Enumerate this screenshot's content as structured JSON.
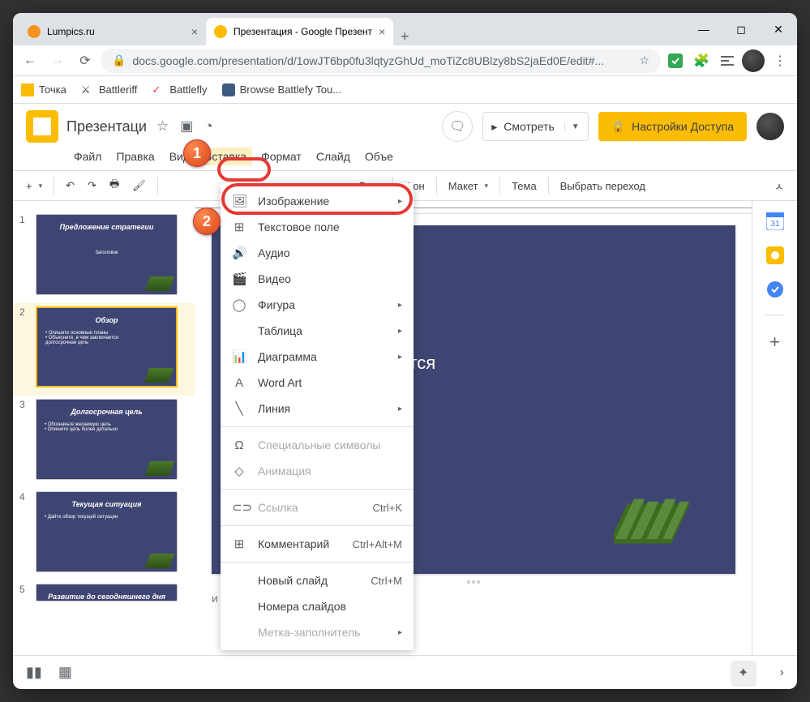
{
  "browser": {
    "tabs": [
      {
        "title": "Lumpics.ru",
        "fav": "#f7931e",
        "active": false
      },
      {
        "title": "Презентация - Google Презент",
        "fav": "#fbbc04",
        "active": true
      }
    ],
    "url": "docs.google.com/presentation/d/1owJT6bp0fu3lqtyzGhUd_moTiZc8UBlzy8bS2jaEd0E/edit#...",
    "bookmarks": [
      "Точка",
      "Battleriff",
      "Battlefly",
      "Browse Battlefy Tou..."
    ]
  },
  "app": {
    "title": "Презентаци",
    "menu": [
      "Файл",
      "Правка",
      "Вид",
      "Вставка",
      "Формат",
      "Слайд",
      "Объе"
    ],
    "menuActiveIndex": 3,
    "present": "Смотреть",
    "share": "Настройки Доступа",
    "comments": "comments"
  },
  "toolbar": {
    "zoom": "Py",
    "bg": "Фон",
    "layout": "Макет",
    "theme": "Тема",
    "transition": "Выбрать переход"
  },
  "insertMenu": [
    {
      "icon": "🖼",
      "label": "Изображение",
      "arrow": true
    },
    {
      "icon": "⊞",
      "label": "Текстовое поле"
    },
    {
      "icon": "🔊",
      "label": "Аудио"
    },
    {
      "icon": "🎬",
      "label": "Видео"
    },
    {
      "icon": "◯",
      "label": "Фигура",
      "arrow": true
    },
    {
      "icon": "",
      "label": "Таблица",
      "arrow": true
    },
    {
      "icon": "📊",
      "label": "Диаграмма",
      "arrow": true
    },
    {
      "icon": "A",
      "label": "Word Art"
    },
    {
      "icon": "╲",
      "label": "Линия",
      "arrow": true
    },
    {
      "div": true
    },
    {
      "icon": "Ω",
      "label": "Специальные символы",
      "disabled": true
    },
    {
      "icon": "◇",
      "label": "Анимация",
      "disabled": true
    },
    {
      "div": true
    },
    {
      "icon": "⊂⊃",
      "label": "Ссылка",
      "shortcut": "Ctrl+K",
      "disabled": true
    },
    {
      "div": true
    },
    {
      "icon": "⊞",
      "label": "Комментарий",
      "shortcut": "Ctrl+Alt+M"
    },
    {
      "div": true
    },
    {
      "icon": "",
      "label": "Новый слайд",
      "shortcut": "Ctrl+M"
    },
    {
      "icon": "",
      "label": "Номера слайдов"
    },
    {
      "icon": "",
      "label": "Метка-заполнитель",
      "arrow": true,
      "disabled": true
    }
  ],
  "thumbs": [
    {
      "n": 1,
      "title": "Предложение стратегии",
      "body": "Заголовок"
    },
    {
      "n": 2,
      "title": "Обзор",
      "body": "• Опишите основные планы\n• Объясните, в чем заключается\n  долгосрочная цель"
    },
    {
      "n": 3,
      "title": "Долгосрочная цель",
      "body": "• Обозначьте желаемую цель\n• Опишите цель более детально"
    },
    {
      "n": 4,
      "title": "Текущая ситуация",
      "body": "• Дайте обзор текущей ситуации"
    },
    {
      "n": 5,
      "title": "Развитие до сегодняшнего дня",
      "body": ""
    }
  ],
  "slide": {
    "title": "Обзор",
    "line1": "основные планы",
    "line2": "е, в чем заключается",
    "line3": "ная цель"
  },
  "notes": "и докладчика",
  "callouts": {
    "b1": "1",
    "b2": "2"
  }
}
